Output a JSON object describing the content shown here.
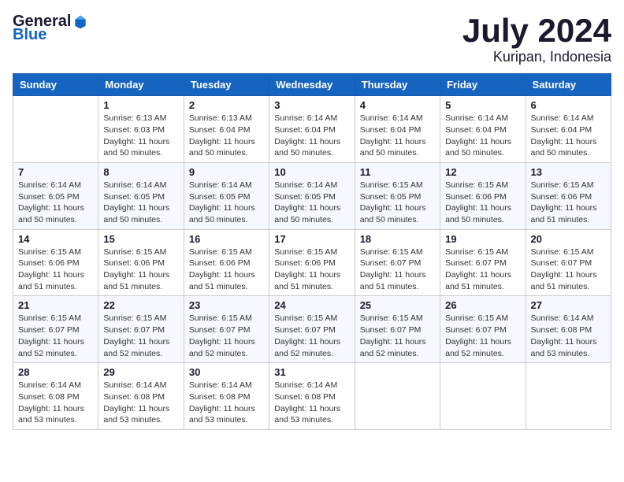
{
  "header": {
    "logo_general": "General",
    "logo_blue": "Blue",
    "month_title": "July 2024",
    "location": "Kuripan, Indonesia"
  },
  "days_of_week": [
    "Sunday",
    "Monday",
    "Tuesday",
    "Wednesday",
    "Thursday",
    "Friday",
    "Saturday"
  ],
  "weeks": [
    [
      {
        "day": "",
        "info": ""
      },
      {
        "day": "1",
        "info": "Sunrise: 6:13 AM\nSunset: 6:03 PM\nDaylight: 11 hours\nand 50 minutes."
      },
      {
        "day": "2",
        "info": "Sunrise: 6:13 AM\nSunset: 6:04 PM\nDaylight: 11 hours\nand 50 minutes."
      },
      {
        "day": "3",
        "info": "Sunrise: 6:14 AM\nSunset: 6:04 PM\nDaylight: 11 hours\nand 50 minutes."
      },
      {
        "day": "4",
        "info": "Sunrise: 6:14 AM\nSunset: 6:04 PM\nDaylight: 11 hours\nand 50 minutes."
      },
      {
        "day": "5",
        "info": "Sunrise: 6:14 AM\nSunset: 6:04 PM\nDaylight: 11 hours\nand 50 minutes."
      },
      {
        "day": "6",
        "info": "Sunrise: 6:14 AM\nSunset: 6:04 PM\nDaylight: 11 hours\nand 50 minutes."
      }
    ],
    [
      {
        "day": "7",
        "info": "Sunrise: 6:14 AM\nSunset: 6:05 PM\nDaylight: 11 hours\nand 50 minutes."
      },
      {
        "day": "8",
        "info": "Sunrise: 6:14 AM\nSunset: 6:05 PM\nDaylight: 11 hours\nand 50 minutes."
      },
      {
        "day": "9",
        "info": "Sunrise: 6:14 AM\nSunset: 6:05 PM\nDaylight: 11 hours\nand 50 minutes."
      },
      {
        "day": "10",
        "info": "Sunrise: 6:14 AM\nSunset: 6:05 PM\nDaylight: 11 hours\nand 50 minutes."
      },
      {
        "day": "11",
        "info": "Sunrise: 6:15 AM\nSunset: 6:05 PM\nDaylight: 11 hours\nand 50 minutes."
      },
      {
        "day": "12",
        "info": "Sunrise: 6:15 AM\nSunset: 6:06 PM\nDaylight: 11 hours\nand 50 minutes."
      },
      {
        "day": "13",
        "info": "Sunrise: 6:15 AM\nSunset: 6:06 PM\nDaylight: 11 hours\nand 51 minutes."
      }
    ],
    [
      {
        "day": "14",
        "info": "Sunrise: 6:15 AM\nSunset: 6:06 PM\nDaylight: 11 hours\nand 51 minutes."
      },
      {
        "day": "15",
        "info": "Sunrise: 6:15 AM\nSunset: 6:06 PM\nDaylight: 11 hours\nand 51 minutes."
      },
      {
        "day": "16",
        "info": "Sunrise: 6:15 AM\nSunset: 6:06 PM\nDaylight: 11 hours\nand 51 minutes."
      },
      {
        "day": "17",
        "info": "Sunrise: 6:15 AM\nSunset: 6:06 PM\nDaylight: 11 hours\nand 51 minutes."
      },
      {
        "day": "18",
        "info": "Sunrise: 6:15 AM\nSunset: 6:07 PM\nDaylight: 11 hours\nand 51 minutes."
      },
      {
        "day": "19",
        "info": "Sunrise: 6:15 AM\nSunset: 6:07 PM\nDaylight: 11 hours\nand 51 minutes."
      },
      {
        "day": "20",
        "info": "Sunrise: 6:15 AM\nSunset: 6:07 PM\nDaylight: 11 hours\nand 51 minutes."
      }
    ],
    [
      {
        "day": "21",
        "info": "Sunrise: 6:15 AM\nSunset: 6:07 PM\nDaylight: 11 hours\nand 52 minutes."
      },
      {
        "day": "22",
        "info": "Sunrise: 6:15 AM\nSunset: 6:07 PM\nDaylight: 11 hours\nand 52 minutes."
      },
      {
        "day": "23",
        "info": "Sunrise: 6:15 AM\nSunset: 6:07 PM\nDaylight: 11 hours\nand 52 minutes."
      },
      {
        "day": "24",
        "info": "Sunrise: 6:15 AM\nSunset: 6:07 PM\nDaylight: 11 hours\nand 52 minutes."
      },
      {
        "day": "25",
        "info": "Sunrise: 6:15 AM\nSunset: 6:07 PM\nDaylight: 11 hours\nand 52 minutes."
      },
      {
        "day": "26",
        "info": "Sunrise: 6:15 AM\nSunset: 6:07 PM\nDaylight: 11 hours\nand 52 minutes."
      },
      {
        "day": "27",
        "info": "Sunrise: 6:14 AM\nSunset: 6:08 PM\nDaylight: 11 hours\nand 53 minutes."
      }
    ],
    [
      {
        "day": "28",
        "info": "Sunrise: 6:14 AM\nSunset: 6:08 PM\nDaylight: 11 hours\nand 53 minutes."
      },
      {
        "day": "29",
        "info": "Sunrise: 6:14 AM\nSunset: 6:08 PM\nDaylight: 11 hours\nand 53 minutes."
      },
      {
        "day": "30",
        "info": "Sunrise: 6:14 AM\nSunset: 6:08 PM\nDaylight: 11 hours\nand 53 minutes."
      },
      {
        "day": "31",
        "info": "Sunrise: 6:14 AM\nSunset: 6:08 PM\nDaylight: 11 hours\nand 53 minutes."
      },
      {
        "day": "",
        "info": ""
      },
      {
        "day": "",
        "info": ""
      },
      {
        "day": "",
        "info": ""
      }
    ]
  ]
}
